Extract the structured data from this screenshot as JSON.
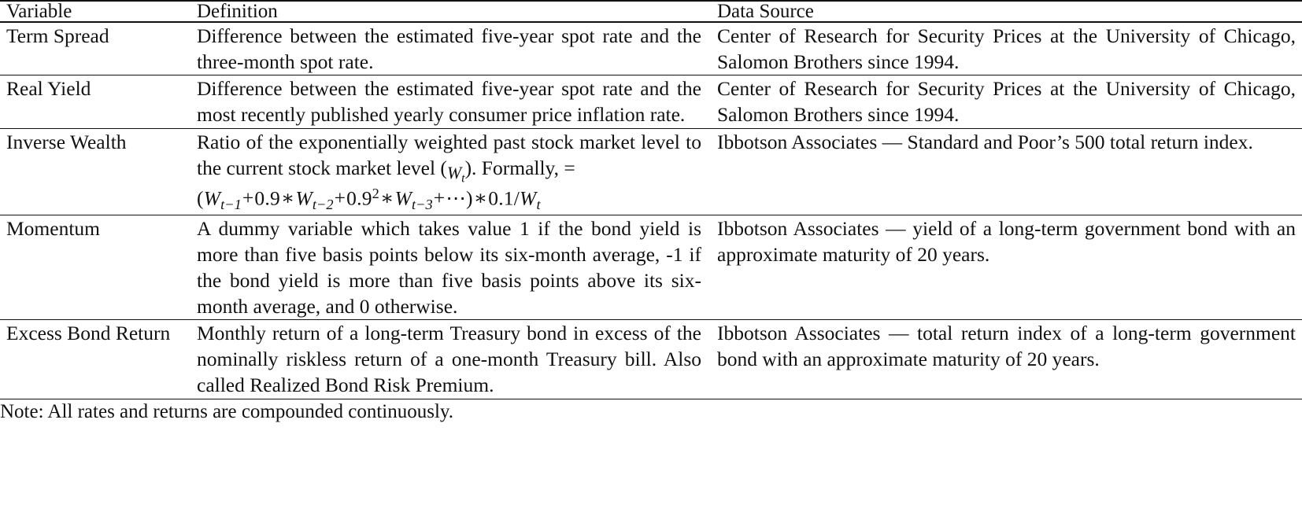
{
  "table": {
    "headers": {
      "variable": "Variable",
      "definition": "Definition",
      "data_source": "Data Source"
    },
    "rows": [
      {
        "variable": "Term Spread",
        "definition": "Difference between the estimated five-year spot rate and the three-month spot rate.",
        "data_source": "Center of Research for Security Prices at the University of Chicago, Salomon Brothers since 1994."
      },
      {
        "variable": "Real Yield",
        "definition": "Difference between the estimated five-year spot rate and the most recently published yearly consumer price inflation rate.",
        "data_source": "Center of Research for Security Prices at the University of Chicago, Salomon Brothers since 1994."
      },
      {
        "variable": "Inverse Wealth",
        "definition_prefix": "Ratio of the exponentially weighted past stock market level to the current stock market level (",
        "definition_symbol": "W",
        "definition_symbol_sub": "t",
        "definition_middle": "). Formally,  =",
        "formula": {
          "open_paren": "(",
          "term1_var": "W",
          "term1_sub": "t−1",
          "plus1": "+",
          "coef2": "0.9",
          "times2": "∗",
          "term2_var": "W",
          "term2_sub": "t−2",
          "plus2": "+",
          "coef3": "0.9",
          "coef3_exp": "2",
          "times3": "∗",
          "term3_var": "W",
          "term3_sub": "t−3",
          "plus3": "+",
          "dots": "⋯",
          "close_paren": ")",
          "times4": "∗",
          "coef4": "0.1/",
          "term4_var": "W",
          "term4_sub": "t"
        },
        "formula_plain": "(W_{t-1} + 0.9 * W_{t-2} + 0.9^2 * W_{t-3} + ⋯) * 0.1/W_t",
        "data_source": "Ibbotson Associates — Standard and Poor’s 500 total return index."
      },
      {
        "variable": "Momentum",
        "definition": "A dummy variable which takes value 1 if the bond yield is more than five basis points below its six-month average, -1 if the bond yield is more than five basis points above its six-month average, and 0 otherwise.",
        "data_source": "Ibbotson Associates — yield of a long-term government bond with an approximate maturity of 20 years."
      },
      {
        "variable": "Excess Bond Return",
        "definition": "Monthly return of a long-term Treasury bond in excess of the nominally riskless return of a one-month Treasury bill. Also called Realized Bond Risk Premium.",
        "data_source": "Ibbotson Associates — total return index of a long-term government bond with an approximate maturity of 20 years."
      }
    ],
    "note": "Note: All rates and returns are compounded continuously."
  },
  "colors": {
    "text": "#111111",
    "rule": "#111111",
    "background": "#ffffff"
  }
}
